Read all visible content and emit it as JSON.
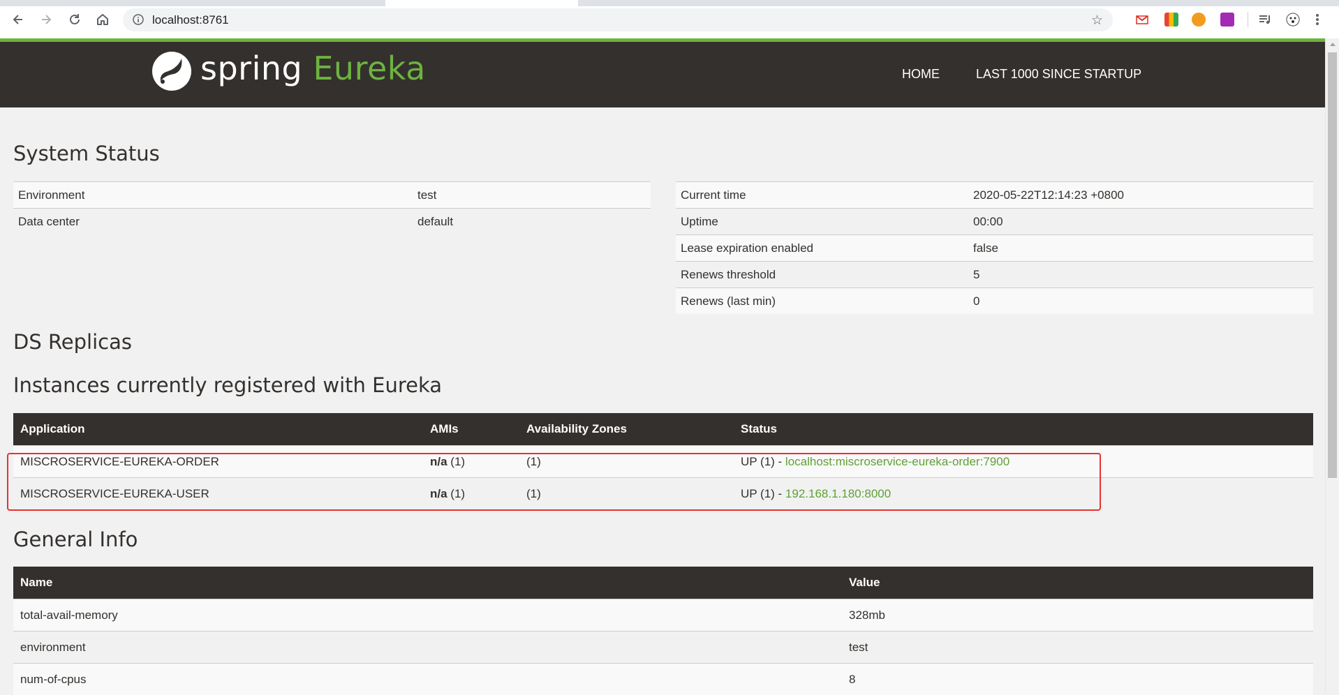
{
  "browser": {
    "url": "localhost:8761"
  },
  "header": {
    "brand_spring": "spring",
    "brand_eureka": "Eureka",
    "nav": [
      {
        "label": "HOME"
      },
      {
        "label": "LAST 1000 SINCE STARTUP"
      }
    ]
  },
  "system_status": {
    "title": "System Status",
    "left": [
      {
        "name": "Environment",
        "value": "test"
      },
      {
        "name": "Data center",
        "value": "default"
      }
    ],
    "right": [
      {
        "name": "Current time",
        "value": "2020-05-22T12:14:23 +0800"
      },
      {
        "name": "Uptime",
        "value": "00:00"
      },
      {
        "name": "Lease expiration enabled",
        "value": "false"
      },
      {
        "name": "Renews threshold",
        "value": "5"
      },
      {
        "name": "Renews (last min)",
        "value": "0"
      }
    ]
  },
  "ds_replicas": {
    "title": "DS Replicas"
  },
  "instances": {
    "title": "Instances currently registered with Eureka",
    "columns": [
      "Application",
      "AMIs",
      "Availability Zones",
      "Status"
    ],
    "rows": [
      {
        "application": "MISCROSERVICE-EUREKA-ORDER",
        "amis_bold": "n/a",
        "amis_count": " (1)",
        "zones": "(1)",
        "status_prefix": "UP (1) - ",
        "status_link": "localhost:miscroservice-eureka-order:7900"
      },
      {
        "application": "MISCROSERVICE-EUREKA-USER",
        "amis_bold": "n/a",
        "amis_count": " (1)",
        "zones": "(1)",
        "status_prefix": "UP (1) - ",
        "status_link": "192.168.1.180:8000"
      }
    ]
  },
  "general_info": {
    "title": "General Info",
    "columns": [
      "Name",
      "Value"
    ],
    "rows": [
      {
        "name": "total-avail-memory",
        "value": "328mb"
      },
      {
        "name": "environment",
        "value": "test"
      },
      {
        "name": "num-of-cpus",
        "value": "8"
      }
    ]
  },
  "colors": {
    "header_bg": "#34302d",
    "brand_green": "#6db33f",
    "link_green": "#5fa134",
    "highlight_red": "#e8312f"
  }
}
